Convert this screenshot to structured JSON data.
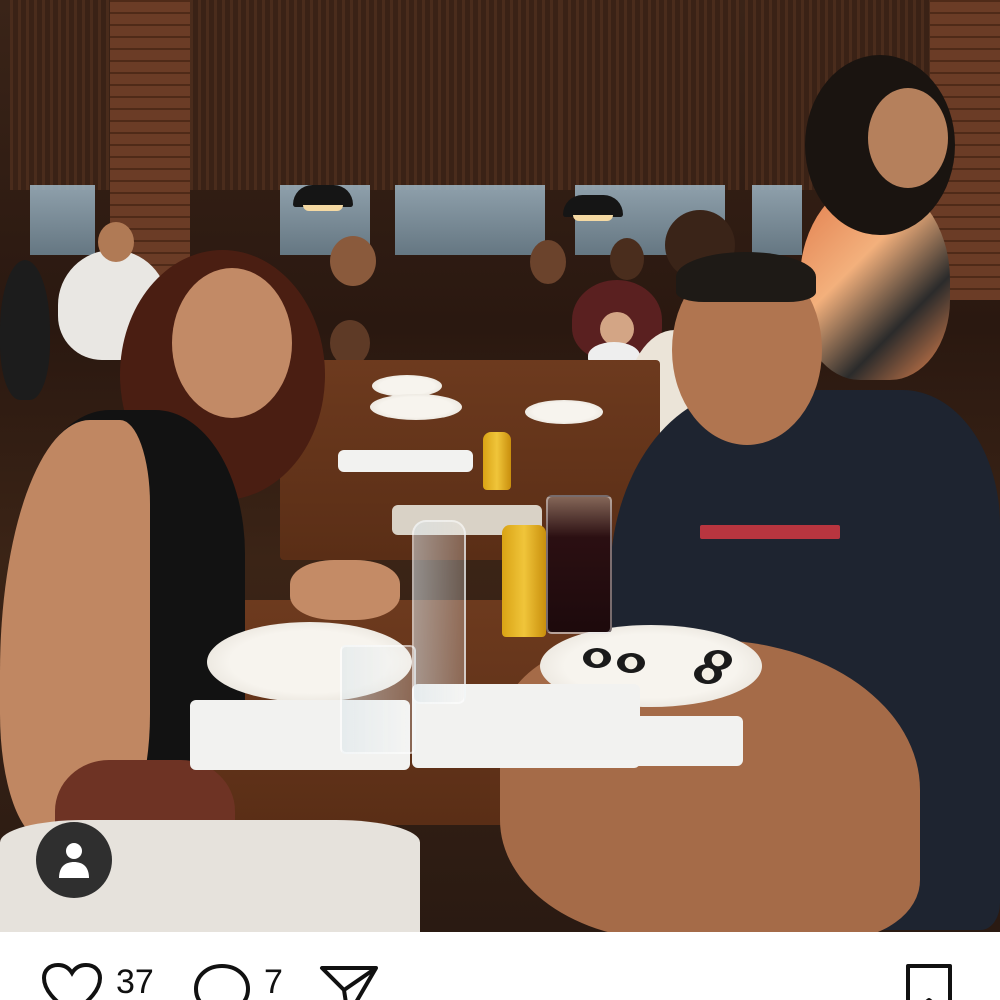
{
  "post": {
    "photo_alt": "",
    "tagged_people_icon": "person-icon",
    "actions": {
      "like_icon": "heart-icon",
      "like_count": "37",
      "comment_icon": "comment-icon",
      "comment_count": "7",
      "share_icon": "send-icon",
      "save_icon": "bookmark-icon"
    }
  },
  "colors": {
    "background": "#ffffff",
    "icon": "#111111",
    "avatar_badge": "#2f2f2f"
  }
}
